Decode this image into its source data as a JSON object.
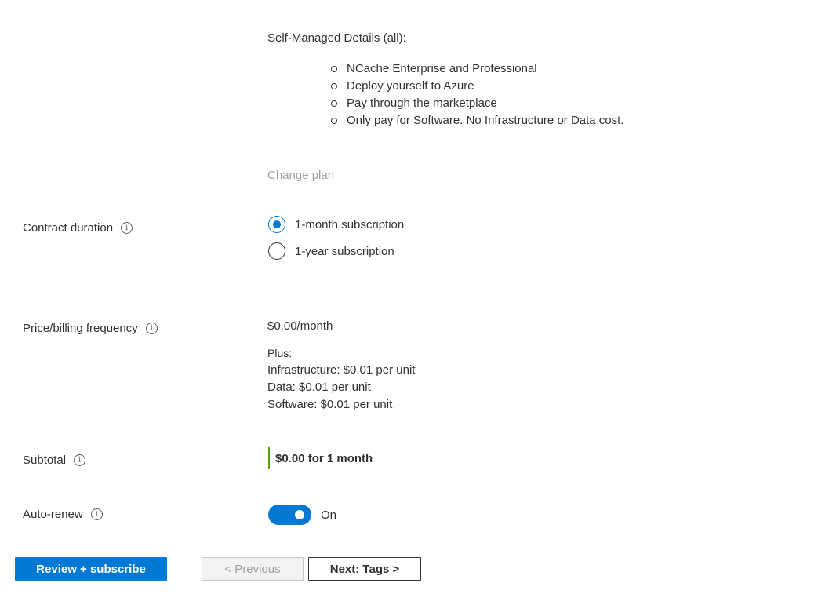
{
  "details": {
    "title": "Self-Managed Details (all):",
    "items": [
      "NCache Enterprise and Professional",
      "Deploy yourself to Azure",
      "Pay through the marketplace",
      "Only pay for Software. No Infrastructure or Data cost."
    ],
    "change_plan": "Change plan"
  },
  "contract": {
    "label": "Contract duration",
    "options": [
      {
        "label": "1-month subscription",
        "selected": true
      },
      {
        "label": "1-year subscription",
        "selected": false
      }
    ]
  },
  "price": {
    "label": "Price/billing frequency",
    "main": "$0.00/month",
    "plus_label": "Plus:",
    "lines": [
      "Infrastructure: $0.01 per unit",
      "Data: $0.01 per unit",
      "Software: $0.01 per unit"
    ]
  },
  "subtotal": {
    "label": "Subtotal",
    "value": "$0.00 for 1 month"
  },
  "auto_renew": {
    "label": "Auto-renew",
    "state_label": "On",
    "enabled": true
  },
  "footer": {
    "review_label": "Review + subscribe",
    "previous_label": "< Previous",
    "next_label": "Next: Tags >"
  },
  "colors": {
    "accent": "#0078d4",
    "subtotal_bar": "#57a300"
  },
  "icons": {
    "info": "info-icon"
  }
}
